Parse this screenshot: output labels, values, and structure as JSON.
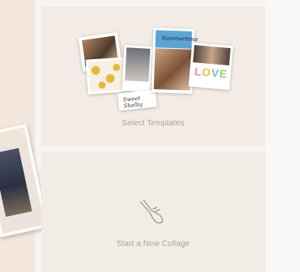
{
  "templates_panel": {
    "label": "Select Templates",
    "cards": {
      "script_text": "Sweet Shelby",
      "banner_text": "Summertime",
      "love_text": "LOVE"
    }
  },
  "collage_panel": {
    "label": "Start a New Collage",
    "icon": "hand-pointer-icon"
  },
  "colors": {
    "panel_bg": "#f3ece6",
    "label_text": "#a8a29c",
    "banner": "#5aa5d8",
    "love_l": "#f08aa8",
    "love_o": "#f2c230",
    "love_v": "#6cc0e6",
    "love_e": "#9bd36a"
  }
}
